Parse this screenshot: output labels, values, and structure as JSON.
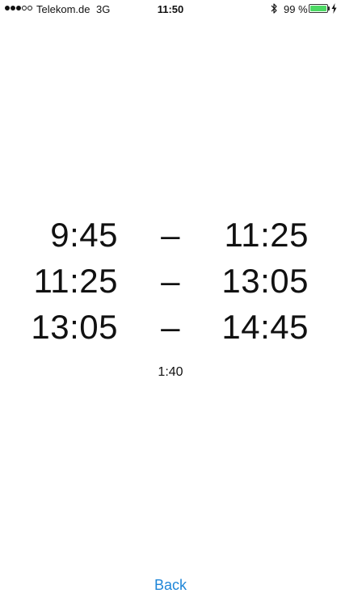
{
  "status_bar": {
    "carrier": "Telekom.de",
    "network": "3G",
    "time": "11:50",
    "battery_percent": "99 %",
    "battery_level": 0.99,
    "signal_bars_filled": 3,
    "signal_bars_total": 5,
    "icons": [
      "bluetooth-icon",
      "battery-icon",
      "charging-bolt-icon"
    ],
    "colors": {
      "battery": "#4cd964"
    }
  },
  "periods": [
    {
      "start": "9:45",
      "separator": "–",
      "end": "11:25"
    },
    {
      "start": "11:25",
      "separator": "–",
      "end": "13:05"
    },
    {
      "start": "13:05",
      "separator": "–",
      "end": "14:45"
    }
  ],
  "duration": "1:40",
  "back_label": "Back",
  "colors": {
    "link": "#1f86d8"
  }
}
